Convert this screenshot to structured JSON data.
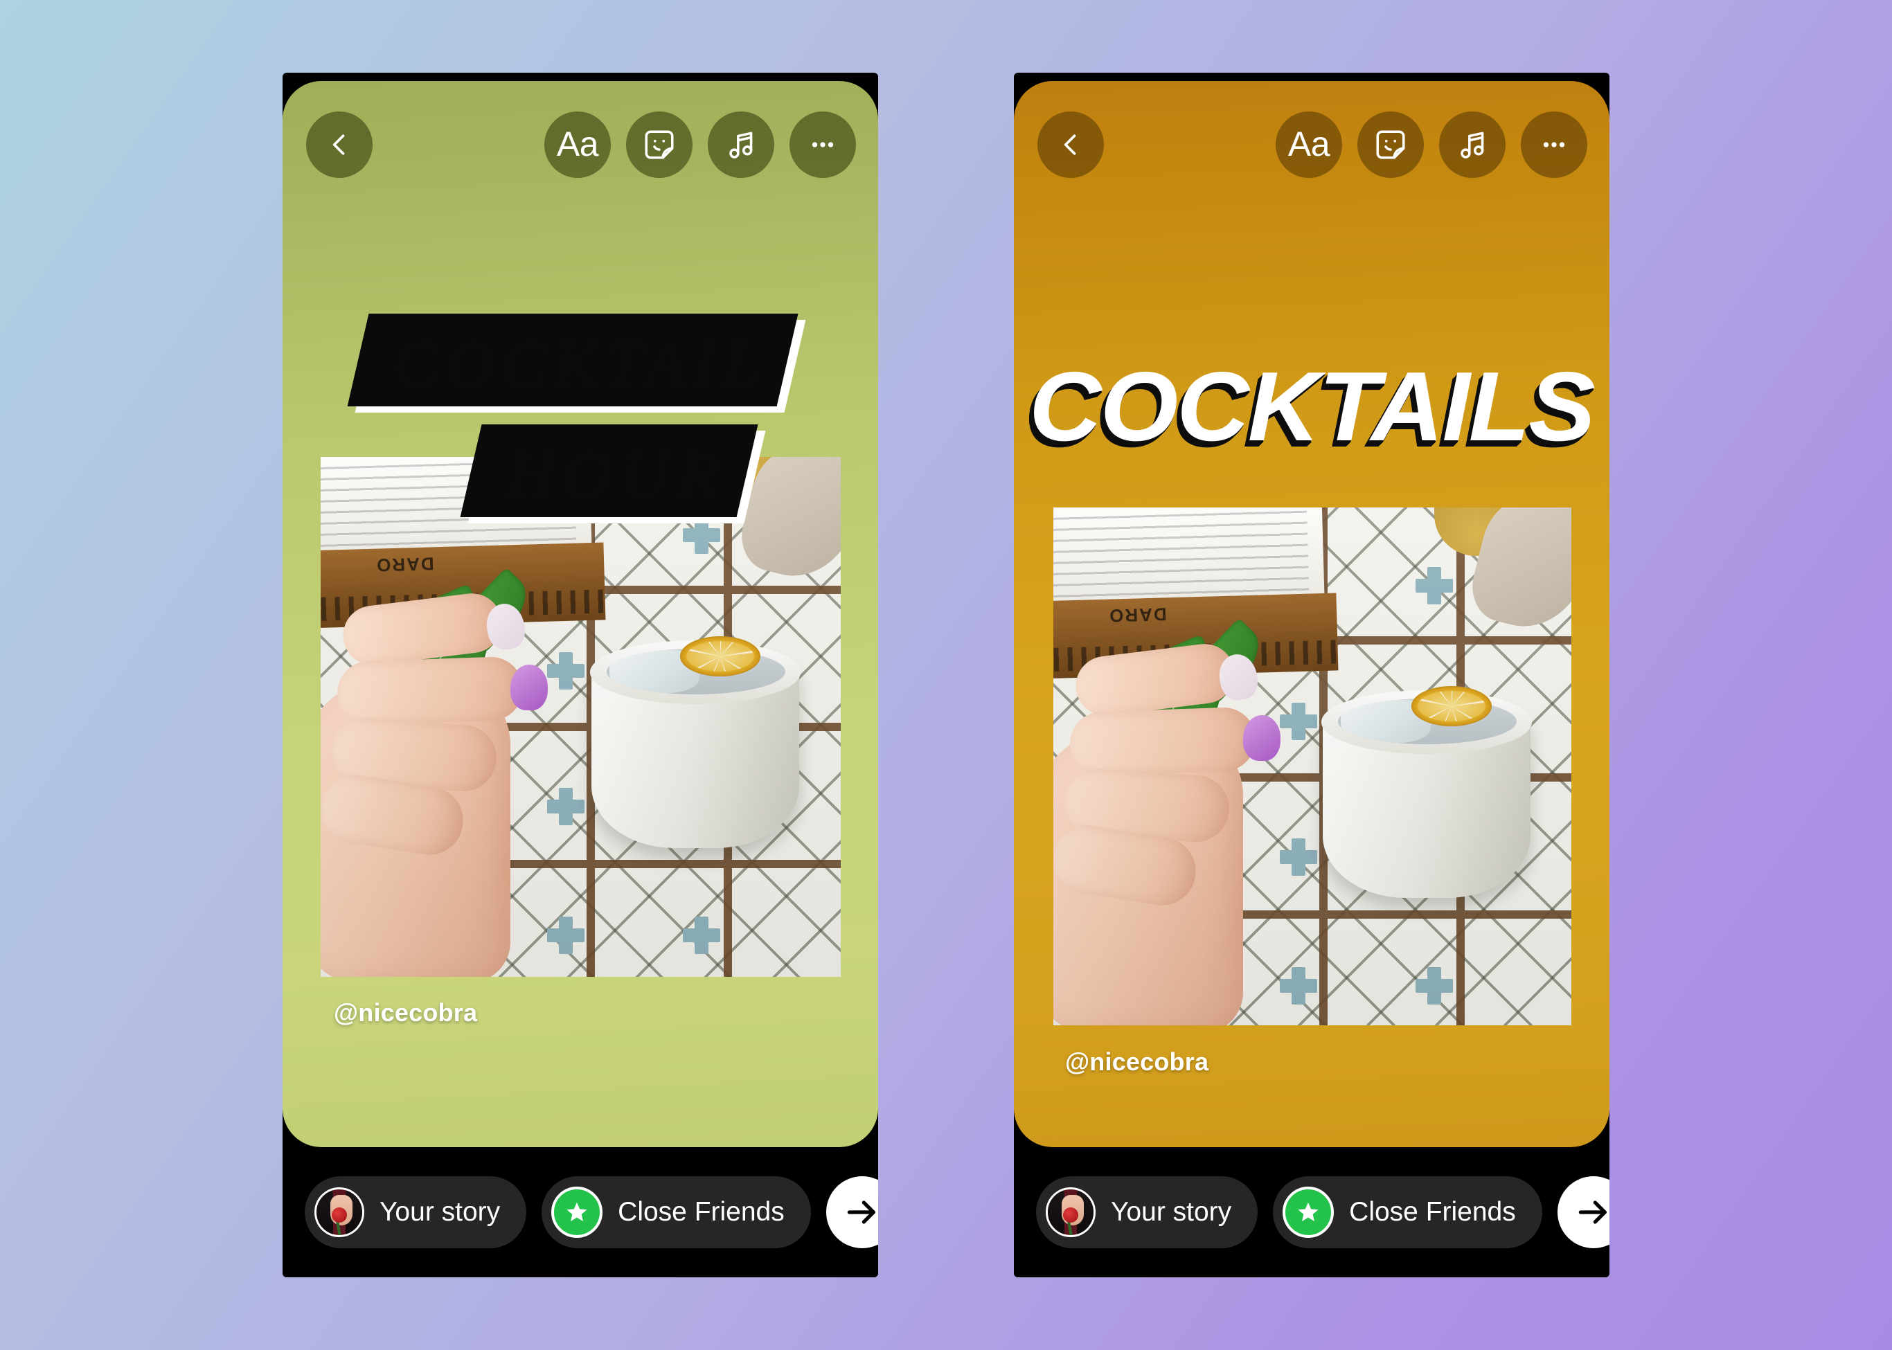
{
  "background": {
    "gradient_from": "#AED2E2",
    "gradient_mid": "#B2ADE4",
    "gradient_to": "#A98BE5"
  },
  "stories": [
    {
      "id": "story-green",
      "theme": "green",
      "canvas_color_top": "#9FAE57",
      "canvas_color_bottom": "#C9D47B",
      "topbar": {
        "back_label": "Back",
        "back_icon": "chevron-left-icon",
        "tools": [
          {
            "name": "text-tool",
            "icon": "text-aa-icon",
            "label": "Aa"
          },
          {
            "name": "sticker-tool",
            "icon": "sticker-smiley-icon",
            "label": "Stickers"
          },
          {
            "name": "music-tool",
            "icon": "music-note-icon",
            "label": "Music"
          },
          {
            "name": "more-tool",
            "icon": "ellipsis-icon",
            "label": "More"
          }
        ]
      },
      "title": {
        "style": "italic-serif-slab",
        "line1": "COCKTAIL",
        "line2": "HOUR",
        "text_color": "#0B0B0B",
        "slab_color": "#FFFFFF",
        "shadow_color": "#0A0A0A"
      },
      "photo": {
        "alt": "Hand holding a white coconut cup cocktail with dried lemon slice and mint on patterned tile table",
        "caption_visible": false
      },
      "handle": "@nicecobra",
      "bottombar": {
        "your_story_label": "Your story",
        "close_friends_label": "Close Friends",
        "send_icon": "arrow-right-icon",
        "avatar_name": "profile-avatar",
        "close_friends_badge_color": "#23C24A"
      }
    },
    {
      "id": "story-amber",
      "theme": "amber",
      "canvas_color_top": "#BE7E10",
      "canvas_color_bottom": "#CF9A1B",
      "topbar": {
        "back_label": "Back",
        "back_icon": "chevron-left-icon",
        "tools": [
          {
            "name": "text-tool",
            "icon": "text-aa-icon",
            "label": "Aa"
          },
          {
            "name": "sticker-tool",
            "icon": "sticker-smiley-icon",
            "label": "Stickers"
          },
          {
            "name": "music-tool",
            "icon": "music-note-icon",
            "label": "Music"
          },
          {
            "name": "more-tool",
            "icon": "ellipsis-icon",
            "label": "More"
          }
        ]
      },
      "title": {
        "style": "bold-italic-sans-shadow",
        "line1": "COCKTAILS",
        "text_color": "#FFFFFF",
        "shadow_color": "#0D0D0D"
      },
      "photo": {
        "alt": "Hand holding a white coconut cup cocktail with dried lemon slice and mint on patterned tile table",
        "caption_visible": false
      },
      "handle": "@nicecobra",
      "bottombar": {
        "your_story_label": "Your story",
        "close_friends_label": "Close Friends",
        "send_icon": "arrow-right-icon",
        "avatar_name": "profile-avatar",
        "close_friends_badge_color": "#23C24A"
      }
    }
  ]
}
